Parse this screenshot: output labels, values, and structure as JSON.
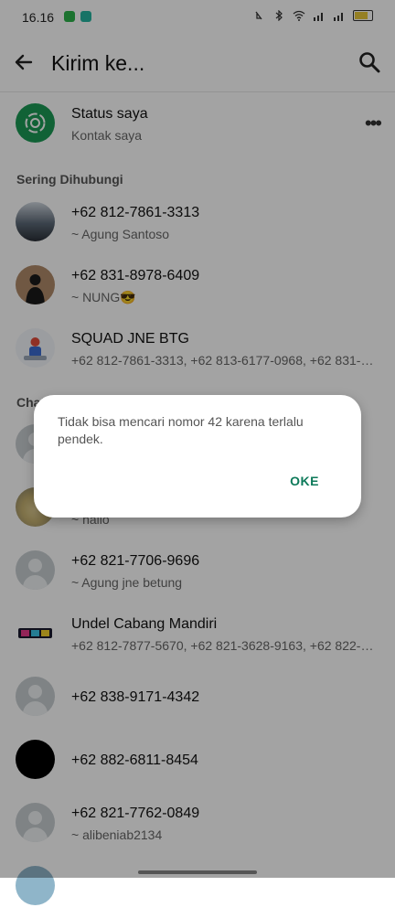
{
  "status_bar": {
    "time": "16.16"
  },
  "app_bar": {
    "title": "Kirim ke..."
  },
  "my_status": {
    "name": "Status saya",
    "sub": "Kontak saya",
    "more": "•••"
  },
  "sections": {
    "frequent": "Sering Dihubungi",
    "chats": "Chat"
  },
  "frequent": [
    {
      "name": "+62 812-7861-3313",
      "sub": "~ Agung Santoso"
    },
    {
      "name": "+62 831-8978-6409",
      "sub": "~ NUNG😎"
    },
    {
      "name": "SQUAD JNE BTG",
      "sub": "+62 812-7861-3313, +62 813-6177-0968, +62 831-6..."
    }
  ],
  "chats": [
    {
      "name": "",
      "sub": ""
    },
    {
      "name": "",
      "sub": "~ hallo"
    },
    {
      "name": "+62 821-7706-9696",
      "sub": "~ Agung jne betung"
    },
    {
      "name": "Undel Cabang Mandiri",
      "sub": "+62 812-7877-5670, +62 821-3628-9163, +62 822-1..."
    },
    {
      "name": "+62 838-9171-4342",
      "sub": ""
    },
    {
      "name": "+62 882-6811-8454",
      "sub": ""
    },
    {
      "name": "+62 821-7762-0849",
      "sub": "~ alibeniab2134"
    }
  ],
  "dialog": {
    "message": "Tidak bisa mencari nomor 42 karena terlalu pendek.",
    "ok": "OKE"
  },
  "colors": {
    "accent": "#0e7a5a",
    "status_green": "#1b9a55"
  }
}
